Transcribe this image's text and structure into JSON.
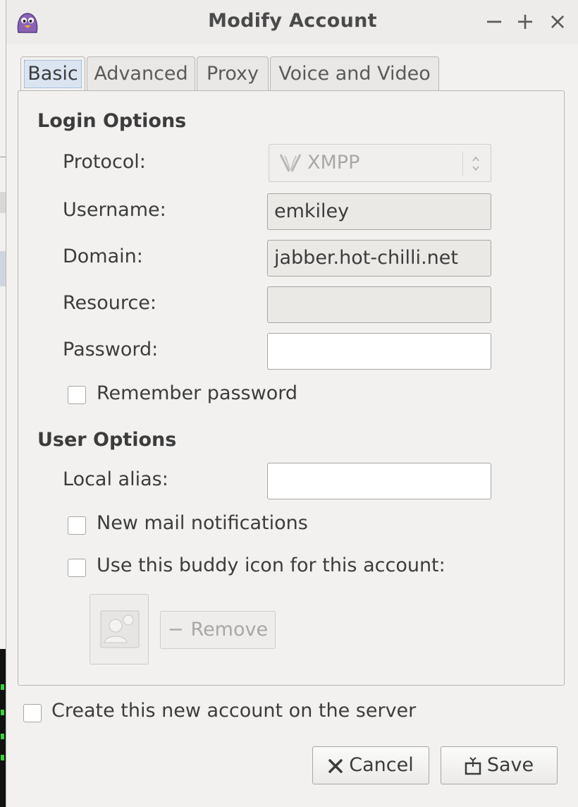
{
  "window": {
    "title": "Modify Account",
    "controls": {
      "minimize": "−",
      "maximize": "+",
      "close": "×"
    }
  },
  "tabs": [
    {
      "label": "Basic",
      "active": true
    },
    {
      "label": "Advanced",
      "active": false
    },
    {
      "label": "Proxy",
      "active": false
    },
    {
      "label": "Voice and Video",
      "active": false
    }
  ],
  "login_options": {
    "title": "Login Options",
    "protocol": {
      "label": "Protocol:",
      "value": "XMPP",
      "icon": "xmpp-icon",
      "enabled": false
    },
    "username": {
      "label": "Username:",
      "value": "emkiley"
    },
    "domain": {
      "label": "Domain:",
      "value": "jabber.hot-chilli.net"
    },
    "resource": {
      "label": "Resource:",
      "value": ""
    },
    "password": {
      "label": "Password:",
      "value": ""
    },
    "remember_password": {
      "label": "Remember password",
      "checked": false
    }
  },
  "user_options": {
    "title": "User Options",
    "local_alias": {
      "label": "Local alias:",
      "value": ""
    },
    "new_mail": {
      "label": "New mail notifications",
      "checked": false
    },
    "buddy_icon": {
      "label": "Use this buddy icon for this account:",
      "checked": false
    },
    "remove_button": {
      "label": "Remove",
      "icon": "minus-icon",
      "enabled": false
    }
  },
  "create_account": {
    "label": "Create this new account on the server",
    "checked": false
  },
  "buttons": {
    "cancel": {
      "label": "Cancel",
      "icon": "close-icon"
    },
    "save": {
      "label": "Save",
      "icon": "save-icon"
    }
  },
  "colors": {
    "window_bg": "#f2f1f0",
    "border": "#b9b7b3",
    "field_disabled": "#ebe9e6",
    "active_tab_focus": "#dbe5f1"
  }
}
